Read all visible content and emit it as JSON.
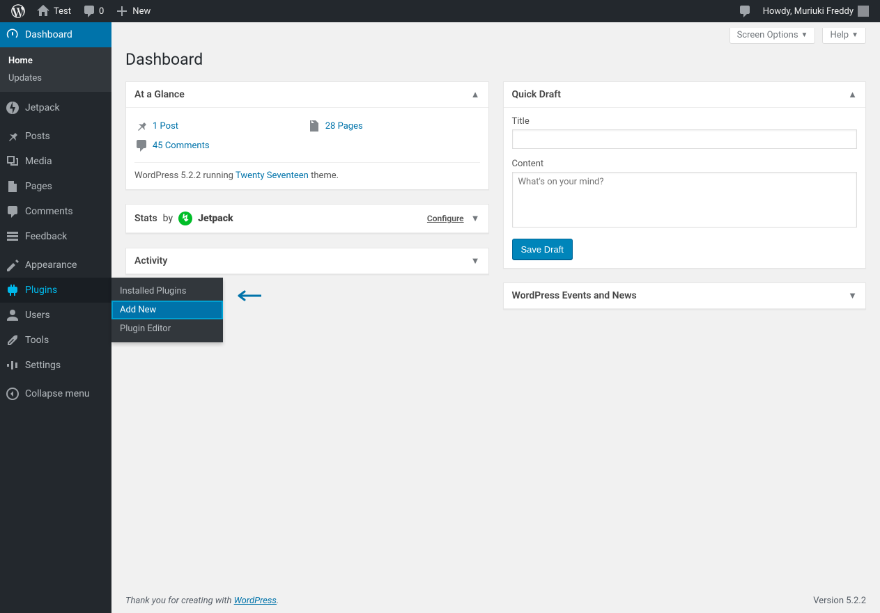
{
  "adminbar": {
    "site_name": "Test",
    "comments_count": "0",
    "new_label": "New",
    "howdy": "Howdy, Muriuki Freddy"
  },
  "menu": {
    "dashboard": "Dashboard",
    "dashboard_sub": {
      "home": "Home",
      "updates": "Updates"
    },
    "jetpack": "Jetpack",
    "posts": "Posts",
    "media": "Media",
    "pages": "Pages",
    "comments": "Comments",
    "feedback": "Feedback",
    "appearance": "Appearance",
    "plugins": "Plugins",
    "plugins_sub": {
      "installed": "Installed Plugins",
      "add_new": "Add New",
      "editor": "Plugin Editor"
    },
    "users": "Users",
    "tools": "Tools",
    "settings": "Settings",
    "collapse": "Collapse menu"
  },
  "screen_meta": {
    "options": "Screen Options",
    "help": "Help"
  },
  "page_title": "Dashboard",
  "glance": {
    "title": "At a Glance",
    "post": "1 Post",
    "pages": "28 Pages",
    "comments": "45 Comments",
    "version_pre": "WordPress 5.2.2 running ",
    "theme": "Twenty Seventeen",
    "version_post": " theme."
  },
  "stats": {
    "pre": "Stats",
    "by": "by",
    "jetpack": "Jetpack",
    "configure": "Configure"
  },
  "activity": {
    "title": "Activity"
  },
  "quickdraft": {
    "title": "Quick Draft",
    "title_label": "Title",
    "content_label": "Content",
    "content_placeholder": "What's on your mind?",
    "save": "Save Draft"
  },
  "events": {
    "title": "WordPress Events and News"
  },
  "footer": {
    "thank_pre": "Thank you for creating with ",
    "wp": "WordPress",
    "thank_post": ".",
    "version": "Version 5.2.2"
  }
}
